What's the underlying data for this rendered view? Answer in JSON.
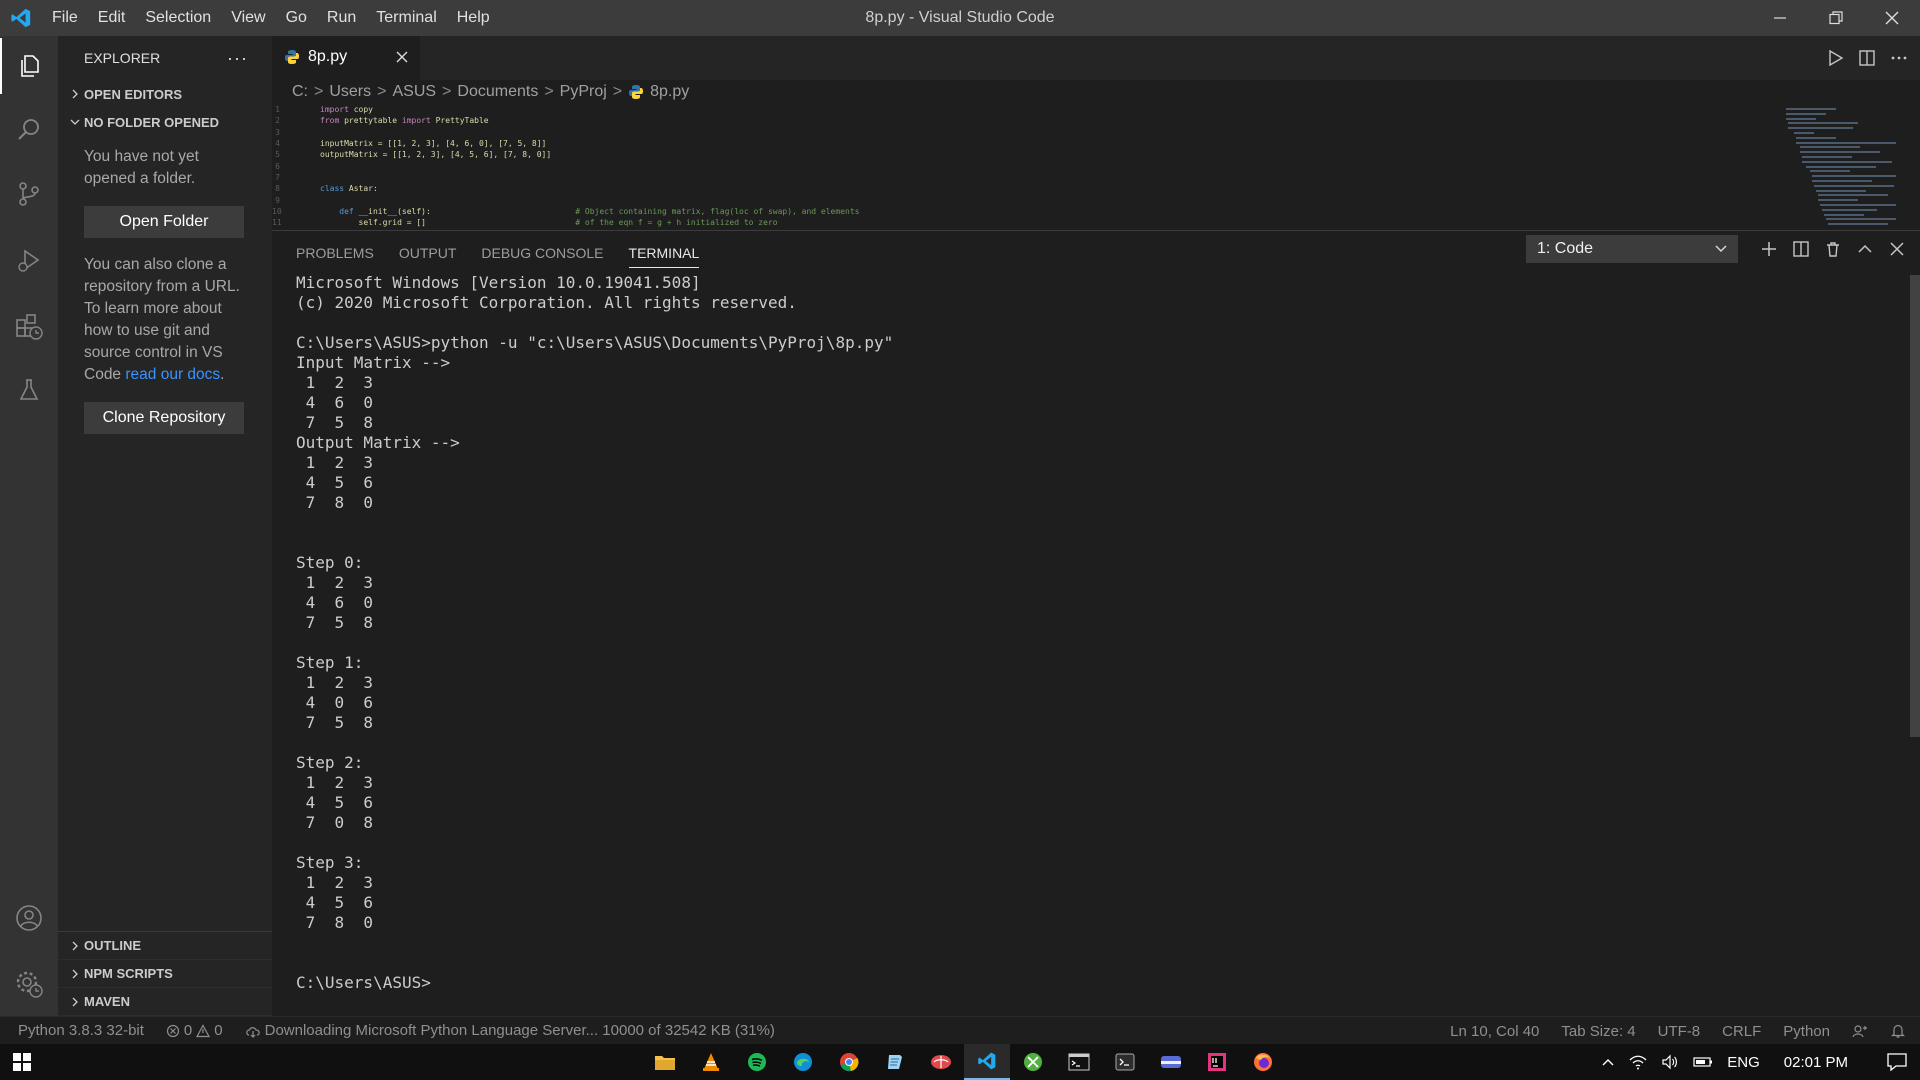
{
  "titlebar": {
    "menu": [
      "File",
      "Edit",
      "Selection",
      "View",
      "Go",
      "Run",
      "Terminal",
      "Help"
    ],
    "title": "8p.py - Visual Studio Code"
  },
  "sidebar": {
    "title": "EXPLORER",
    "more": "···",
    "open_editors": "OPEN EDITORS",
    "no_folder": "NO FOLDER OPENED",
    "msg1": "You have not yet opened a folder.",
    "open_folder_btn": "Open Folder",
    "msg2": "You can also clone a repository from a URL. To learn more about how to use git and source control in VS Code",
    "docs_link": "read our docs",
    "clone_btn": "Clone Repository",
    "outline": "OUTLINE",
    "npm": "NPM SCRIPTS",
    "maven": "MAVEN"
  },
  "editor": {
    "tab_label": "8p.py",
    "breadcrumb": [
      "C:",
      "Users",
      "ASUS",
      "Documents",
      "PyProj",
      "8p.py"
    ],
    "code": [
      {
        "n": "1",
        "parts": [
          [
            "kw",
            "import"
          ],
          [
            "",
            " copy"
          ]
        ]
      },
      {
        "n": "2",
        "parts": [
          [
            "kw",
            "from"
          ],
          [
            "",
            " prettytable "
          ],
          [
            "kw",
            "import"
          ],
          [
            "",
            " PrettyTable"
          ]
        ]
      },
      {
        "n": "3",
        "parts": []
      },
      {
        "n": "4",
        "parts": [
          [
            "",
            "inputMatrix = [[1, 2, 3], [4, 6, 0], [7, 5, 8]]"
          ]
        ]
      },
      {
        "n": "5",
        "parts": [
          [
            "",
            "outputMatrix = [[1, 2, 3], [4, 5, 6], [7, 8, 0]]"
          ]
        ]
      },
      {
        "n": "6",
        "parts": []
      },
      {
        "n": "7",
        "parts": []
      },
      {
        "n": "8",
        "parts": [
          [
            "cls",
            "class"
          ],
          [
            "",
            " Astar:"
          ]
        ]
      },
      {
        "n": "9",
        "parts": []
      },
      {
        "n": "10",
        "parts": [
          [
            "",
            "    "
          ],
          [
            "cls",
            "def"
          ],
          [
            "",
            " __init__(self):                              "
          ],
          [
            "cm",
            "# Object containing matrix, flag(loc of swap), and elements"
          ]
        ]
      },
      {
        "n": "11",
        "parts": [
          [
            "",
            "        self.grid = []                               "
          ],
          [
            "cm",
            "# of the eqn f = g + h initialized to zero"
          ]
        ]
      }
    ]
  },
  "panel": {
    "tabs": [
      "PROBLEMS",
      "OUTPUT",
      "DEBUG CONSOLE",
      "TERMINAL"
    ],
    "active_tab": "TERMINAL",
    "terminal_select": "1: Code",
    "terminal_text": "Microsoft Windows [Version 10.0.19041.508]\n(c) 2020 Microsoft Corporation. All rights reserved.\n\nC:\\Users\\ASUS>python -u \"c:\\Users\\ASUS\\Documents\\PyProj\\8p.py\"\nInput Matrix -->\n 1  2  3\n 4  6  0\n 7  5  8\nOutput Matrix -->\n 1  2  3\n 4  5  6\n 7  8  0\n\n\nStep 0:\n 1  2  3\n 4  6  0\n 7  5  8\n\nStep 1:\n 1  2  3\n 4  0  6\n 7  5  8\n\nStep 2:\n 1  2  3\n 4  5  6\n 7  0  8\n\nStep 3:\n 1  2  3\n 4  5  6\n 7  8  0\n\n\nC:\\Users\\ASUS>"
  },
  "statusbar": {
    "python": "Python 3.8.3 32-bit",
    "errors": "0",
    "warnings": "0",
    "download": "Downloading Microsoft Python Language Server... 10000 of 32542 KB (31%)",
    "position": "Ln 10, Col 40",
    "tabsize": "Tab Size: 4",
    "encoding": "UTF-8",
    "eol": "CRLF",
    "language": "Python"
  },
  "taskbar": {
    "lang": "ENG",
    "time": "02:01 PM"
  },
  "colors": {
    "accent_vscode": "#23a9f2",
    "python_blue": "#3572a5",
    "python_yellow": "#ffd43b"
  }
}
